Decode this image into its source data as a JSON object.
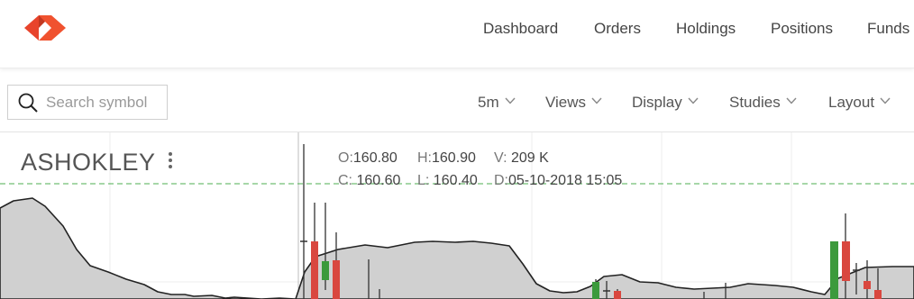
{
  "colors": {
    "brand": "#e8442c",
    "brand_dark": "#c23821",
    "up_candle": "#3c9a3c",
    "down_candle": "#d9473f",
    "area_fill": "#d0d0d0",
    "area_line": "#222222",
    "ref_line": "#4caf50",
    "grid": "#ececec"
  },
  "header": {
    "logo_icon": "kite-logo-icon",
    "nav": [
      {
        "label": "Dashboard"
      },
      {
        "label": "Orders"
      },
      {
        "label": "Holdings"
      },
      {
        "label": "Positions"
      },
      {
        "label": "Funds"
      }
    ]
  },
  "toolbar": {
    "search": {
      "placeholder": "Search symbol",
      "value": "",
      "icon": "search-icon"
    },
    "interval": {
      "label": "5m",
      "icon": "chevron-down-icon"
    },
    "views": {
      "label": "Views",
      "icon": "chevron-down-icon"
    },
    "display": {
      "label": "Display",
      "icon": "chevron-down-icon"
    },
    "studies": {
      "label": "Studies",
      "icon": "chevron-down-icon"
    },
    "layout": {
      "label": "Layout",
      "icon": "chevron-down-icon"
    }
  },
  "chart": {
    "symbol": "ASHOKLEY",
    "menu_icon": "more-vertical-icon",
    "ohlc": {
      "open_label": "O:",
      "open": "160.80",
      "high_label": "H:",
      "high": "160.90",
      "volume_label": "V:",
      "volume": "209 K",
      "close_label": "C:",
      "close": "160.60",
      "low_label": "L:",
      "low": "160.40",
      "date_label": "D:",
      "date": "05-10-2018 15:05"
    }
  }
}
